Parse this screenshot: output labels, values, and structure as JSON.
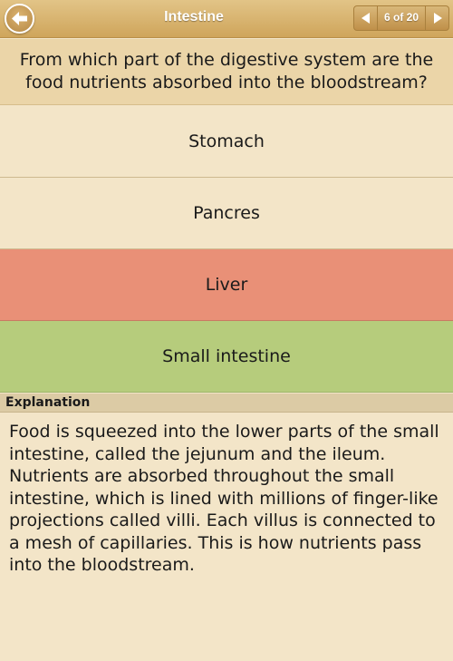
{
  "header": {
    "back_icon": "back-arrow-icon",
    "title": "Intestine",
    "pager": {
      "prev_icon": "triangle-left-icon",
      "counter": "6 of 20",
      "next_icon": "triangle-right-icon"
    }
  },
  "question": {
    "text": "From which part of the digestive system are the food nutrients absorbed into the bloodstream?"
  },
  "answers": [
    {
      "label": "Stomach",
      "state": "neutral"
    },
    {
      "label": "Pancres",
      "state": "neutral"
    },
    {
      "label": "Liver",
      "state": "wrong"
    },
    {
      "label": "Small intestine",
      "state": "correct"
    }
  ],
  "explanation": {
    "header": "Explanation",
    "text": "Food is squeezed into the lower parts of the small intestine, called the jejunum and the ileum. Nutrients are absorbed throughout the small intestine, which is lined with millions of finger-like projections called villi. Each villus is connected to a mesh of capillaries. This is how nutrients pass into the bloodstream."
  },
  "colors": {
    "background": "#f3e5c8",
    "header_bar": "#cfa55b",
    "question_bg": "#ebd5a8",
    "wrong": "#e99077",
    "correct": "#b6cc7c"
  }
}
